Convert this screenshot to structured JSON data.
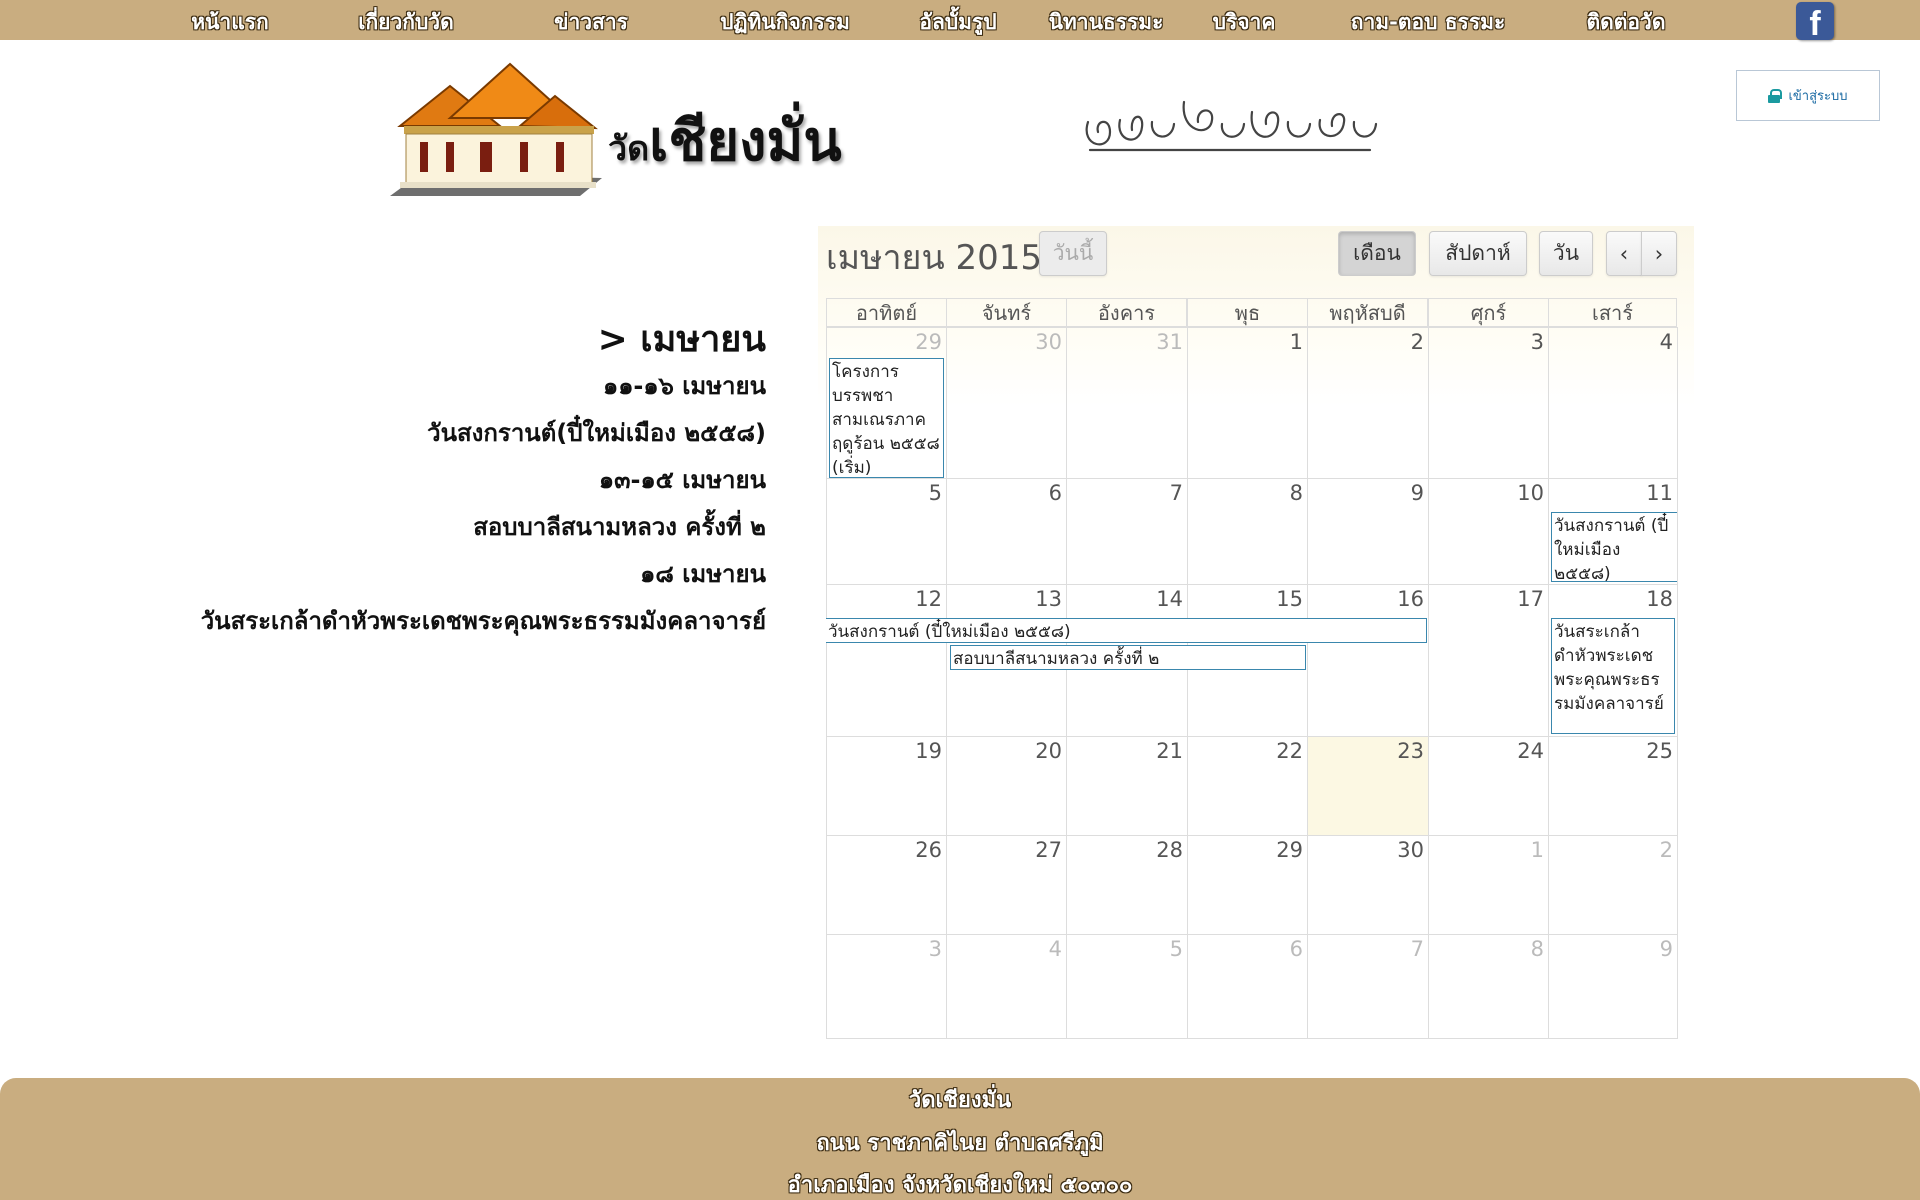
{
  "nav": {
    "items": [
      {
        "label": "หน้าแรก"
      },
      {
        "label": "เกี่ยวกับวัด"
      },
      {
        "label": "ข่าวสาร"
      },
      {
        "label": "ปฏิทินกิจกรรม"
      },
      {
        "label": "อัลบั้มรูป"
      },
      {
        "label": "นิทานธรรมะ"
      },
      {
        "label": "บริจาค"
      },
      {
        "label": "ถาม-ตอบ ธรรมะ"
      },
      {
        "label": "ติดต่อวัด"
      }
    ],
    "facebook_glyph": "f"
  },
  "header": {
    "title_prefix": "วัด",
    "title_main": "เชียงมั่น",
    "lanna_script": "ᩅᩢ᩠ᨯᨩ᩠ᨿᨦᨾᩢ᩠ᨶ",
    "login_label": "เข้าสู่ระบบ"
  },
  "events_list": {
    "heading": "> เมษายน",
    "lines": [
      "๑๑-๑๖ เมษายน",
      "วันสงกรานต์(ปี๋ใหม่เมือง ๒๕๕๘)",
      "๑๓-๑๕ เมษายน",
      "สอบบาลีสนามหลวง ครั้งที่ ๒",
      "๑๘ เมษายน",
      "วันสระเกล้าดำหัวพระเดชพระคุณพระธรรมมังคลาจารย์"
    ]
  },
  "calendar": {
    "title": "เมษายน 2015",
    "today_button": "วันนี้",
    "view_month": "เดือน",
    "view_week": "สัปดาห์",
    "view_day": "วัน",
    "prev": "‹",
    "next": "›",
    "weekdays": [
      "อาทิตย์",
      "จันทร์",
      "อังคาร",
      "พุธ",
      "พฤหัสบดี",
      "ศุกร์",
      "เสาร์"
    ],
    "weeks": [
      [
        "29",
        "30",
        "31",
        "1",
        "2",
        "3",
        "4"
      ],
      [
        "5",
        "6",
        "7",
        "8",
        "9",
        "10",
        "11"
      ],
      [
        "12",
        "13",
        "14",
        "15",
        "16",
        "17",
        "18"
      ],
      [
        "19",
        "20",
        "21",
        "22",
        "23",
        "24",
        "25"
      ],
      [
        "26",
        "27",
        "28",
        "29",
        "30",
        "1",
        "2"
      ],
      [
        "3",
        "4",
        "5",
        "6",
        "7",
        "8",
        "9"
      ]
    ],
    "events": {
      "ordination": "โครงการบรรพชาสามเณรภาคฤดูร้อน ๒๕๕๘ (เริ่ม)",
      "songkran_start": "วันสงกรานต์ (ปี๋ใหม่เมือง ๒๕๕๘)",
      "songkran_cont": "วันสงกรานต์ (ปี๋ใหม่เมือง ๒๕๕๘)",
      "pali_exam": "สอบบาลีสนามหลวง ครั้งที่ ๒",
      "dam_hua": "วันสระเกล้าดำหัวพระเดชพระคุณพระธรรมมังคลาจารย์"
    }
  },
  "footer": {
    "line1": "วัดเชียงมั่น",
    "line2": "ถนน ราชภาคิไนย ตำบลศรีภูมิ",
    "line3": "อำเภอเมือง จังหวัดเชียงใหม่ ๕๐๓๐๐"
  },
  "colors": {
    "nav_bg": "#c9ad80",
    "event_border": "#3a87ad",
    "today_bg": "#fcf8e3"
  }
}
